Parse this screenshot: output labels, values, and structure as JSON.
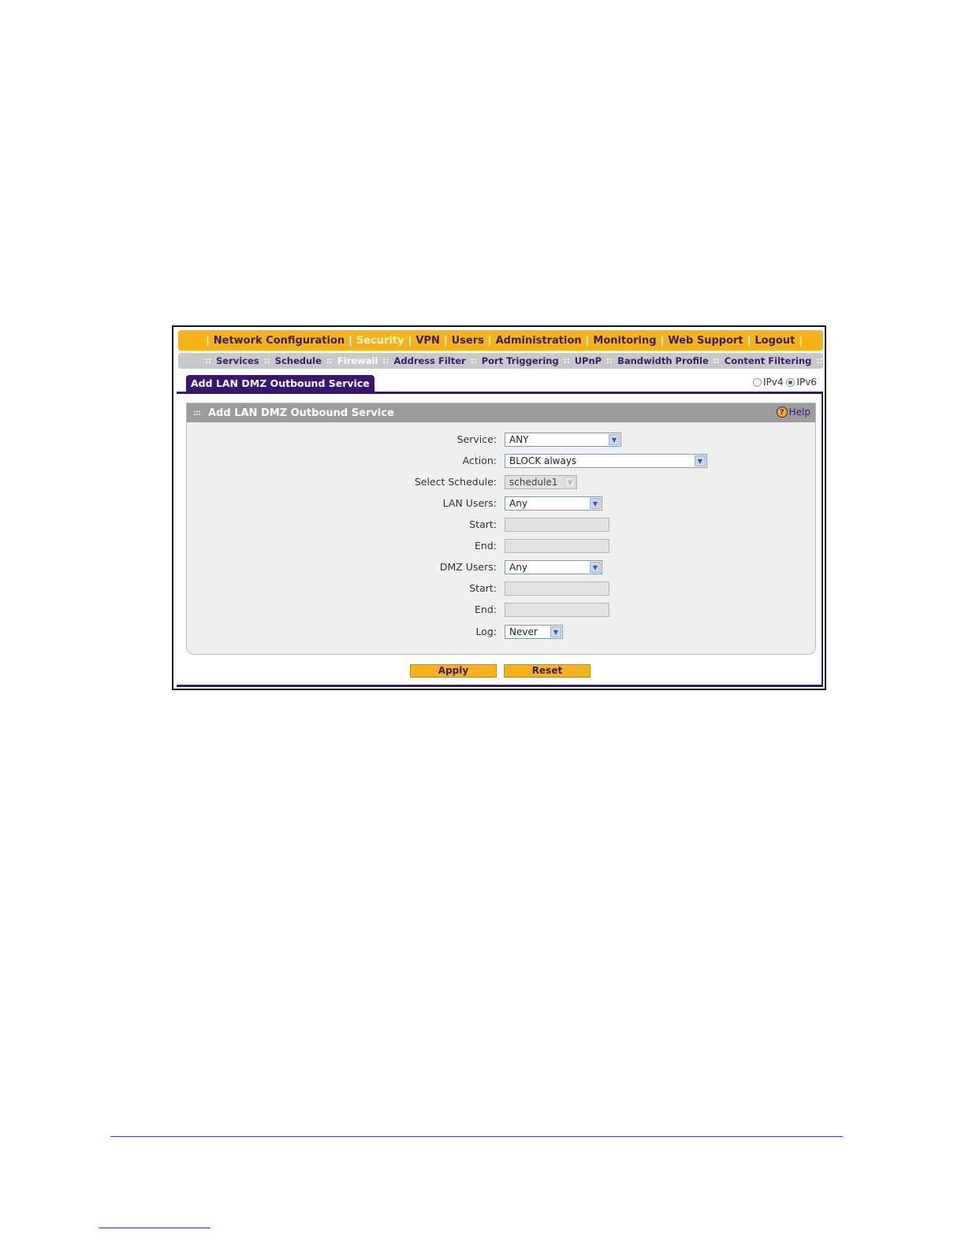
{
  "main_nav": {
    "items": [
      {
        "label": "Network Configuration",
        "active": false
      },
      {
        "label": "Security",
        "active": true
      },
      {
        "label": "VPN",
        "active": false
      },
      {
        "label": "Users",
        "active": false
      },
      {
        "label": "Administration",
        "active": false
      },
      {
        "label": "Monitoring",
        "active": false
      },
      {
        "label": "Web Support",
        "active": false
      },
      {
        "label": "Logout",
        "active": false
      }
    ]
  },
  "sub_nav": {
    "items": [
      {
        "label": "Services",
        "active": false
      },
      {
        "label": "Schedule",
        "active": false
      },
      {
        "label": "Firewall",
        "active": true
      },
      {
        "label": "Address Filter",
        "active": false
      },
      {
        "label": "Port Triggering",
        "active": false
      },
      {
        "label": "UPnP",
        "active": false
      },
      {
        "label": "Bandwidth Profile",
        "active": false
      },
      {
        "label": "Content Filtering",
        "active": false
      }
    ]
  },
  "tab": {
    "label": "Add LAN DMZ Outbound Service"
  },
  "ip_version": {
    "ipv4_label": "IPv4",
    "ipv6_label": "IPv6",
    "selected": "IPv6"
  },
  "panel": {
    "title": "Add LAN DMZ Outbound Service",
    "help_label": "Help",
    "fields": {
      "service": {
        "label": "Service:",
        "value": "ANY"
      },
      "action": {
        "label": "Action:",
        "value": "BLOCK always"
      },
      "select_schedule": {
        "label": "Select Schedule:",
        "value": "schedule1"
      },
      "lan_users": {
        "label": "LAN Users:",
        "value": "Any"
      },
      "lan_start": {
        "label": "Start:",
        "value": ""
      },
      "lan_end": {
        "label": "End:",
        "value": ""
      },
      "dmz_users": {
        "label": "DMZ Users:",
        "value": "Any"
      },
      "dmz_start": {
        "label": "Start:",
        "value": ""
      },
      "dmz_end": {
        "label": "End:",
        "value": ""
      },
      "log": {
        "label": "Log:",
        "value": "Never"
      }
    }
  },
  "buttons": {
    "apply": "Apply",
    "reset": "Reset"
  }
}
